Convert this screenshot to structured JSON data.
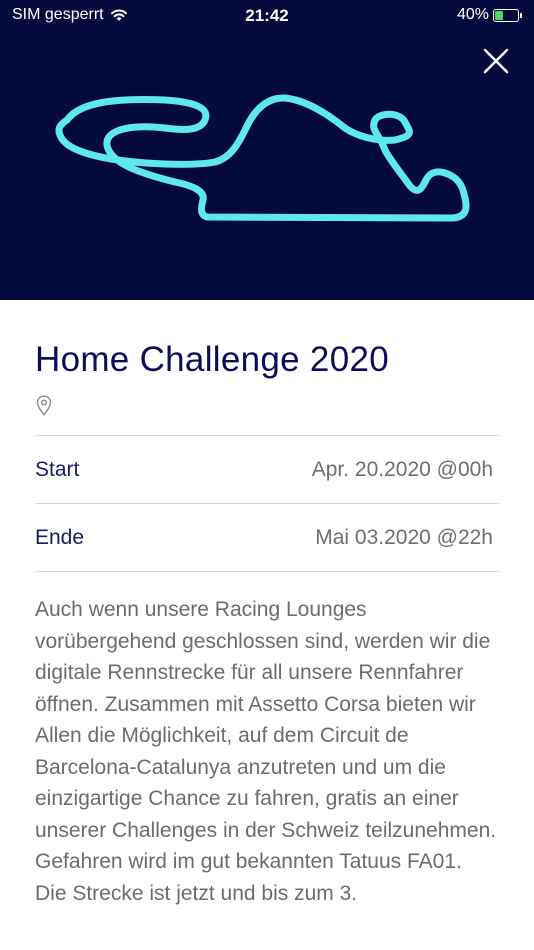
{
  "status_bar": {
    "carrier": "SIM gesperrt",
    "time": "21:42",
    "battery_percent": "40%",
    "battery_level": 0.4
  },
  "event": {
    "title": "Home Challenge 2020",
    "details": [
      {
        "label": "Start",
        "value": "Apr. 20.2020 @00h"
      },
      {
        "label": "Ende",
        "value": "Mai 03.2020 @22h"
      }
    ],
    "description": "Auch wenn unsere Racing Lounges vorübergehend geschlossen sind, werden wir die digitale Rennstrecke für all unsere Rennfahrer öffnen. Zusammen mit Assetto Corsa bieten wir Allen die Möglichkeit, auf dem Circuit de Barcelona-Catalunya anzutreten und um die einzigartige Chance zu fahren, gratis an einer unserer Challenges in der Schweiz teilzunehmen. Gefahren wird im gut bekannten Tatuus FA01. Die Strecke ist jetzt und bis zum 3."
  },
  "colors": {
    "hero_background": "#050a3e",
    "track_line": "#5ee8ee",
    "title": "#0d0b5a"
  },
  "icons": [
    "wifi-icon",
    "battery-icon",
    "close-icon",
    "location-pin-icon"
  ]
}
